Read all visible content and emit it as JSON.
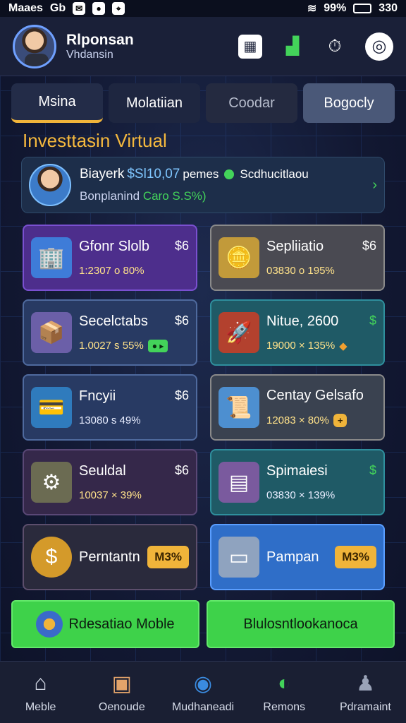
{
  "status": {
    "carrier": "Maaes",
    "g": "Gb",
    "battery": "99%",
    "time": "330"
  },
  "header": {
    "name": "Rlponsan",
    "subname": "Vhdansin"
  },
  "tabs": [
    "Msina",
    "Molatiian",
    "Coodar",
    "Bogocly"
  ],
  "section_title": "Investtasin Virtual",
  "summary": {
    "line1_label": "Biayerk",
    "line1_value": "$Sl10,07",
    "line1_small": "pemes",
    "line1_right": "Scdhucitlaou",
    "line2_label": "Bonplanind",
    "line2_value": "Caro S.S%)"
  },
  "cards": [
    {
      "title": "Gfonr Slolb",
      "amount": "$6",
      "sub": "1:2307 o 80%",
      "icon": "building-icon"
    },
    {
      "title": "Sepliiatio",
      "amount": "$6",
      "sub": "03830 o 195%",
      "icon": "coins-icon"
    },
    {
      "title": "Secelctabs",
      "amount": "$6",
      "sub": "1.0027 s 55%",
      "icon": "box-icon"
    },
    {
      "title": "Nitue, 2600",
      "amount": "$",
      "sub": "19000 × 135%",
      "icon": "rocket-icon"
    },
    {
      "title": "Fncyii",
      "amount": "$6",
      "sub": "13080 s 49%",
      "icon": "card-icon"
    },
    {
      "title": "Centay Gelsafo",
      "amount": "",
      "sub": "12083 × 80%",
      "icon": "paper-icon"
    },
    {
      "title": "Seuldal",
      "amount": "$6",
      "sub": "10037 × 39%",
      "icon": "engine-icon"
    },
    {
      "title": "Spimaiesi",
      "amount": "$",
      "sub": "03830 × 139%",
      "icon": "layers-icon"
    },
    {
      "title": "Perntantn",
      "amount": "",
      "sub": "",
      "badge": "M3%",
      "icon": "dollar-icon"
    },
    {
      "title": "Pampan",
      "amount": "",
      "sub": "",
      "badge": "M3%",
      "icon": "tile-icon"
    }
  ],
  "buttons": [
    "Rdesatiao Moble",
    "Blulosntlookanoca"
  ],
  "nav": [
    "Meble",
    "Oenoude",
    "Mudhaneadi",
    "Remons",
    "Pdramaint"
  ]
}
